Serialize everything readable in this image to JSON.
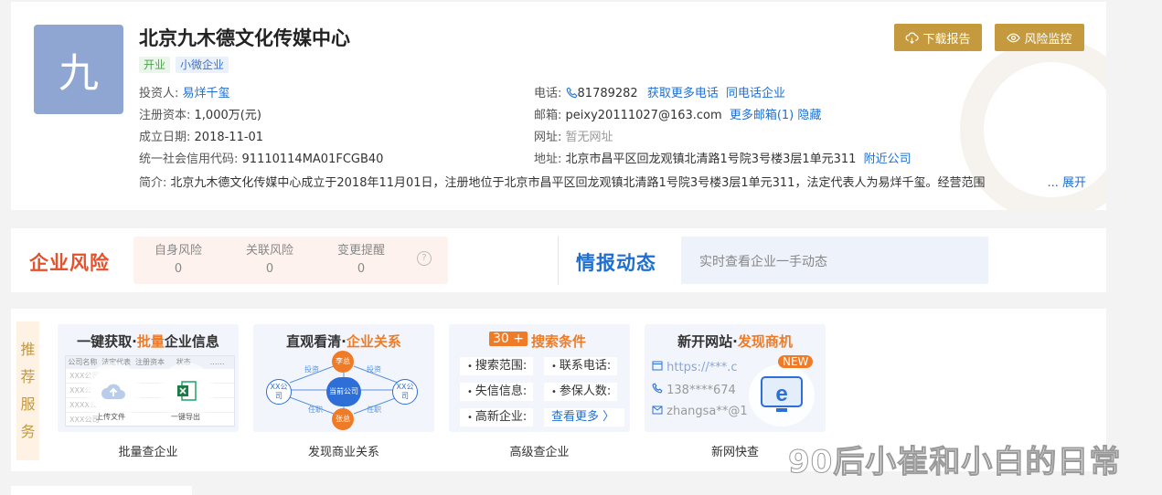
{
  "company": {
    "logo_char": "九",
    "name": "北京九木德文化传媒中心",
    "tags": [
      "开业",
      "小微企业"
    ]
  },
  "actions": {
    "download": "下载报告",
    "monitor": "风险监控"
  },
  "info": {
    "investor_label": "投资人:",
    "investor": "易烊千玺",
    "capital_label": "注册资本:",
    "capital": "1,000万(元)",
    "founded_label": "成立日期:",
    "founded": "2018-11-01",
    "credit_label": "统一社会信用代码:",
    "credit": "91110114MA01FCGB40",
    "phone_label": "电话:",
    "phone": "81789282",
    "phone_more": "获取更多电话",
    "phone_same": "同电话企业",
    "email_label": "邮箱:",
    "email": "peixy20111027@163.com",
    "email_more": "更多邮箱(1)",
    "email_hide": "隐藏",
    "site_label": "网址:",
    "site": "暂无网址",
    "address_label": "地址:",
    "address": "北京市昌平区回龙观镇北清路1号院3号楼3层1单元311",
    "address_near": "附近公司",
    "intro_label": "简介:",
    "intro": "北京九木德文化传媒中心成立于2018年11月01日，注册地位于北京市昌平区回龙观镇北清路1号院3号楼3层1单元311，法定代表人为易烊千玺。经营范围",
    "intro_more": "... 展开"
  },
  "risk": {
    "title": "企业风险",
    "items": [
      {
        "label": "自身风险",
        "count": "0"
      },
      {
        "label": "关联风险",
        "count": "0"
      },
      {
        "label": "变更提醒",
        "count": "0"
      }
    ],
    "help": "?"
  },
  "intel": {
    "title": "情报动态",
    "hint": "实时查看企业一手动态"
  },
  "recommend": {
    "side_label": [
      "推",
      "荐",
      "服",
      "务"
    ],
    "tiles": [
      {
        "title_a": "一键获取·",
        "title_o": "批量",
        "title_b": "企业信息",
        "cols": [
          "公司名称",
          "法定代表人",
          "注册资本",
          "状态",
          "……"
        ],
        "rows": [
          "XXX公司",
          "XXX公司",
          "XXXX公司",
          "XXX公司"
        ],
        "upload": "上传文件",
        "export": "一键导出",
        "caption": "批量查企业"
      },
      {
        "title_a": "直观看清·",
        "title_o": "企业关系",
        "title_b": "",
        "center": "当前公司",
        "left": "XX公司",
        "right": "XX公司",
        "top": "李总",
        "bottom": "张总",
        "e1": "投资",
        "e2": "投资",
        "e3": "任职",
        "e4": "任职",
        "caption": "发现商业关系"
      },
      {
        "badge": "30 +",
        "title_o": "搜索条件",
        "items": [
          "搜索范围:",
          "联系电话:",
          "失信信息:",
          "参保人数:",
          "高新企业:"
        ],
        "more": "查看更多 〉",
        "caption": "高级查企业"
      },
      {
        "title_a": "新开网站·",
        "title_o": "发现商机",
        "title_b": "",
        "url": "https://***.c",
        "phone": "138****674",
        "mail": "zhangsa**@1",
        "new": "NEW",
        "caption": "新网快查"
      }
    ]
  },
  "watermark": "90后小崔和小白的日常",
  "colors": {
    "gold": "#c59a3f",
    "risk_red": "#e8502b",
    "link_blue": "#1f6fd1",
    "orange": "#f07b26"
  }
}
